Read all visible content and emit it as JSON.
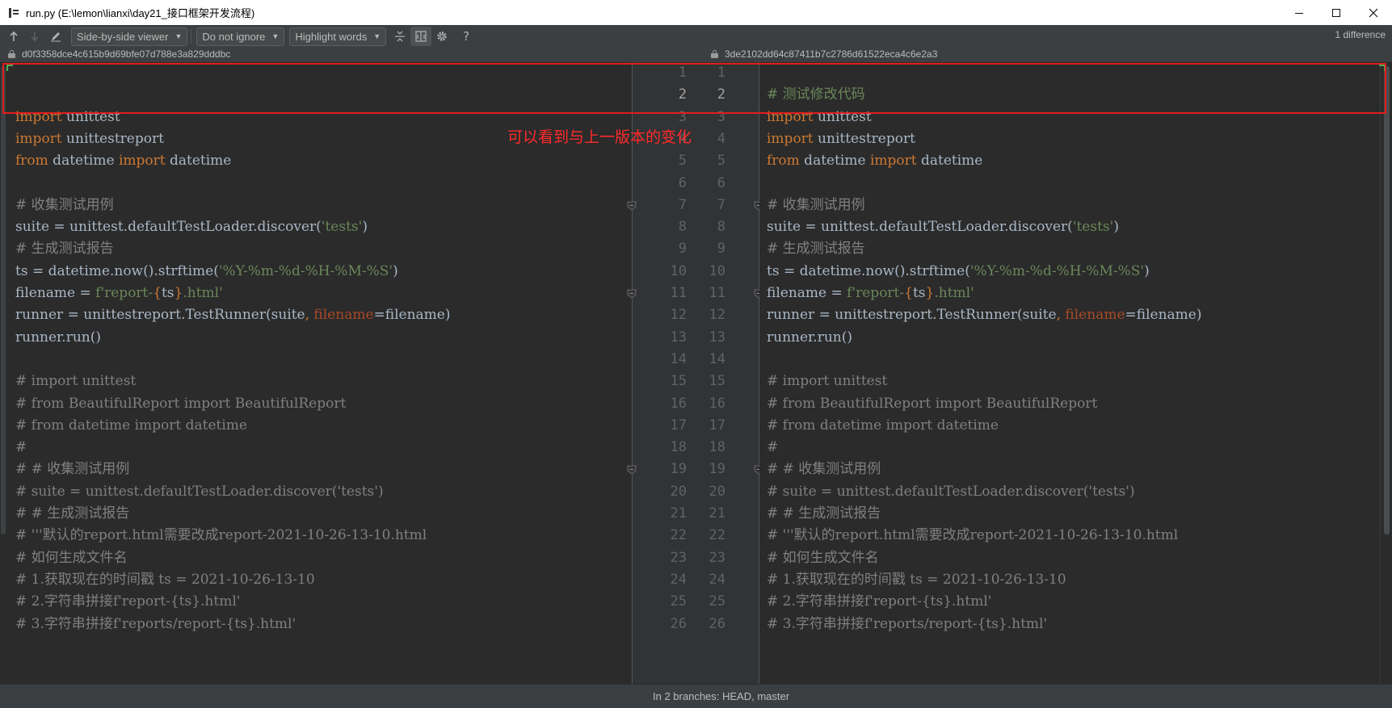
{
  "window": {
    "title": "run.py (E:\\lemon\\lianxi\\day21_接口框架开发流程)",
    "minimize_icon": "minimize-icon",
    "maximize_icon": "maximize-icon",
    "close_icon": "close-icon"
  },
  "toolbar": {
    "viewer_mode": "Side-by-side viewer",
    "whitespace_mode": "Do not ignore",
    "highlight_mode": "Highlight words",
    "difference_count": "1 difference",
    "help_label": "?"
  },
  "revisions": {
    "left_hash": "d0f3358dce4c615b9d69bfe07d788e3a829dddbc",
    "right_hash": "3de2102dd64c87411b7c2786d61522eca4c6e2a3"
  },
  "annotation": {
    "note": "可以看到与上一版本的变化"
  },
  "left_lines": [
    {
      "n": "1",
      "segs": []
    },
    {
      "n": "2",
      "segs": []
    },
    {
      "n": "3",
      "segs": [
        [
          "kw",
          "import"
        ],
        [
          "",
          " unittest"
        ]
      ]
    },
    {
      "n": "4",
      "segs": [
        [
          "kw",
          "import"
        ],
        [
          "",
          " unittestreport"
        ]
      ]
    },
    {
      "n": "5",
      "segs": [
        [
          "kw",
          "from"
        ],
        [
          "",
          " datetime "
        ],
        [
          "kw",
          "import"
        ],
        [
          "",
          " datetime"
        ]
      ]
    },
    {
      "n": "6",
      "segs": []
    },
    {
      "n": "7",
      "segs": [
        [
          "cm",
          "# 收集测试用例"
        ]
      ]
    },
    {
      "n": "8",
      "segs": [
        [
          "",
          "suite = unittest.defaultTestLoader.discover("
        ],
        [
          "str",
          "'tests'"
        ],
        [
          "",
          ")"
        ]
      ]
    },
    {
      "n": "9",
      "segs": [
        [
          "cm",
          "# 生成测试报告"
        ]
      ]
    },
    {
      "n": "10",
      "segs": [
        [
          "",
          "ts = datetime.now().strftime("
        ],
        [
          "str",
          "'%Y-%m-%d-%H-%M-%S'"
        ],
        [
          "",
          ")"
        ]
      ]
    },
    {
      "n": "11",
      "segs": [
        [
          "",
          "filename = "
        ],
        [
          "str",
          "f'report-"
        ],
        [
          "kw",
          "{"
        ],
        [
          "",
          "ts"
        ],
        [
          "kw",
          "}"
        ],
        [
          "str",
          ".html'"
        ]
      ]
    },
    {
      "n": "12",
      "segs": [
        [
          "",
          "runner = unittestreport.TestRunner(suite"
        ],
        [
          "kw",
          ", "
        ],
        [
          "par",
          "filename"
        ],
        [
          "",
          "=filename)"
        ]
      ]
    },
    {
      "n": "13",
      "segs": [
        [
          "",
          "runner.run()"
        ]
      ]
    },
    {
      "n": "14",
      "segs": []
    },
    {
      "n": "15",
      "segs": [
        [
          "cm",
          "# import unittest"
        ]
      ]
    },
    {
      "n": "16",
      "segs": [
        [
          "cm",
          "# from BeautifulReport import BeautifulReport"
        ]
      ]
    },
    {
      "n": "17",
      "segs": [
        [
          "cm",
          "# from datetime import datetime"
        ]
      ]
    },
    {
      "n": "18",
      "segs": [
        [
          "cm",
          "#"
        ]
      ]
    },
    {
      "n": "19",
      "segs": [
        [
          "cm",
          "# # 收集测试用例"
        ]
      ]
    },
    {
      "n": "20",
      "segs": [
        [
          "cm",
          "# suite = unittest.defaultTestLoader.discover('tests')"
        ]
      ]
    },
    {
      "n": "21",
      "segs": [
        [
          "cm",
          "# # 生成测试报告"
        ]
      ]
    },
    {
      "n": "22",
      "segs": [
        [
          "cm",
          "# '''默认的report.html需要改成report-2021-10-26-13-10.html"
        ]
      ]
    },
    {
      "n": "23",
      "segs": [
        [
          "cm",
          "# 如何生成文件名"
        ]
      ]
    },
    {
      "n": "24",
      "segs": [
        [
          "cm",
          "# 1.获取现在的时间戳 ts = 2021-10-26-13-10"
        ]
      ]
    },
    {
      "n": "25",
      "segs": [
        [
          "cm",
          "# 2.字符串拼接f'report-{ts}.html'"
        ]
      ]
    },
    {
      "n": "26",
      "segs": [
        [
          "cm",
          "# 3.字符串拼接f'reports/report-{ts}.html'"
        ]
      ]
    }
  ],
  "right_lines": [
    {
      "n": "1",
      "segs": []
    },
    {
      "n": "2",
      "segs": [
        [
          "str",
          "# 测试修改代码"
        ]
      ]
    },
    {
      "n": "3",
      "segs": [
        [
          "kw",
          "import"
        ],
        [
          "",
          " unittest"
        ]
      ]
    },
    {
      "n": "4",
      "segs": [
        [
          "kw",
          "import"
        ],
        [
          "",
          " unittestreport"
        ]
      ]
    },
    {
      "n": "5",
      "segs": [
        [
          "kw",
          "from"
        ],
        [
          "",
          " datetime "
        ],
        [
          "kw",
          "import"
        ],
        [
          "",
          " datetime"
        ]
      ]
    },
    {
      "n": "6",
      "segs": []
    },
    {
      "n": "7",
      "segs": [
        [
          "cm",
          "# 收集测试用例"
        ]
      ]
    },
    {
      "n": "8",
      "segs": [
        [
          "",
          "suite = unittest.defaultTestLoader.discover("
        ],
        [
          "str",
          "'tests'"
        ],
        [
          "",
          ")"
        ]
      ]
    },
    {
      "n": "9",
      "segs": [
        [
          "cm",
          "# 生成测试报告"
        ]
      ]
    },
    {
      "n": "10",
      "segs": [
        [
          "",
          "ts = datetime.now().strftime("
        ],
        [
          "str",
          "'%Y-%m-%d-%H-%M-%S'"
        ],
        [
          "",
          ")"
        ]
      ]
    },
    {
      "n": "11",
      "segs": [
        [
          "",
          "filename = "
        ],
        [
          "str",
          "f'report-"
        ],
        [
          "kw",
          "{"
        ],
        [
          "",
          "ts"
        ],
        [
          "kw",
          "}"
        ],
        [
          "str",
          ".html'"
        ]
      ]
    },
    {
      "n": "12",
      "segs": [
        [
          "",
          "runner = unittestreport.TestRunner(suite"
        ],
        [
          "kw",
          ", "
        ],
        [
          "par",
          "filename"
        ],
        [
          "",
          "=filename)"
        ]
      ]
    },
    {
      "n": "13",
      "segs": [
        [
          "",
          "runner.run()"
        ]
      ]
    },
    {
      "n": "14",
      "segs": []
    },
    {
      "n": "15",
      "segs": [
        [
          "cm",
          "# import unittest"
        ]
      ]
    },
    {
      "n": "16",
      "segs": [
        [
          "cm",
          "# from BeautifulReport import BeautifulReport"
        ]
      ]
    },
    {
      "n": "17",
      "segs": [
        [
          "cm",
          "# from datetime import datetime"
        ]
      ]
    },
    {
      "n": "18",
      "segs": [
        [
          "cm",
          "#"
        ]
      ]
    },
    {
      "n": "19",
      "segs": [
        [
          "cm",
          "# # 收集测试用例"
        ]
      ]
    },
    {
      "n": "20",
      "segs": [
        [
          "cm",
          "# suite = unittest.defaultTestLoader.discover('tests')"
        ]
      ]
    },
    {
      "n": "21",
      "segs": [
        [
          "cm",
          "# # 生成测试报告"
        ]
      ]
    },
    {
      "n": "22",
      "segs": [
        [
          "cm",
          "# '''默认的report.html需要改成report-2021-10-26-13-10.html"
        ]
      ]
    },
    {
      "n": "23",
      "segs": [
        [
          "cm",
          "# 如何生成文件名"
        ]
      ]
    },
    {
      "n": "24",
      "segs": [
        [
          "cm",
          "# 1.获取现在的时间戳 ts = 2021-10-26-13-10"
        ]
      ]
    },
    {
      "n": "25",
      "segs": [
        [
          "cm",
          "# 2.字符串拼接f'report-{ts}.html'"
        ]
      ]
    },
    {
      "n": "26",
      "segs": [
        [
          "cm",
          "# 3.字符串拼接f'reports/report-{ts}.html'"
        ]
      ]
    }
  ],
  "status": {
    "branches": "In 2 branches: HEAD, master"
  }
}
